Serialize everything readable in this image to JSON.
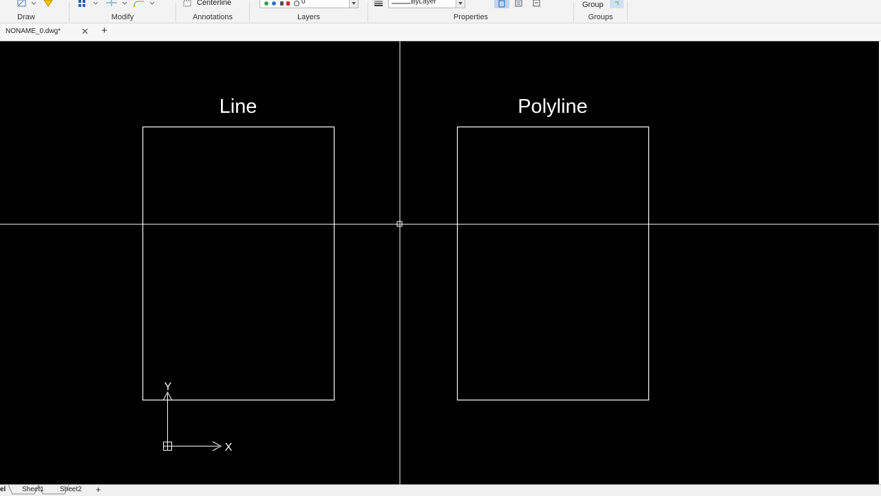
{
  "ribbon": {
    "panels": {
      "draw": "Draw",
      "modify": "Modify",
      "annotations": "Annotations",
      "layers": "Layers",
      "properties": "Properties",
      "groups": "Groups"
    },
    "centerline_label": "Centerline",
    "layer_value": "0",
    "linetype_value": "ByLayer",
    "group_label": "Group"
  },
  "document_tab": {
    "filename": "NONAME_0.dwg*"
  },
  "canvas": {
    "left_label": "Line",
    "right_label": "Polyline",
    "ucs_x": "X",
    "ucs_y": "Y",
    "background": "#000000",
    "stroke": "#ffffff"
  },
  "sheets": {
    "model_fragment": "el",
    "sheet1": "Sheet1",
    "sheet2": "Sheet2"
  }
}
